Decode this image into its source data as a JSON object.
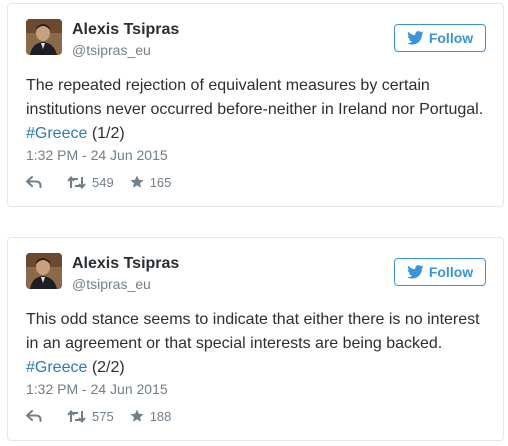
{
  "colors": {
    "accent": "#3b94d9",
    "hashtag": "#2b7bb9",
    "muted": "#707f8a",
    "text": "#292f33",
    "border": "#e1e8ed"
  },
  "tweets": [
    {
      "author": "Alexis Tsipras",
      "handle": "@tsipras_eu",
      "follow_label": "Follow",
      "text_line1": "The repeated rejection of equivalent measures by certain",
      "text_line2": "institutions never occurred before-neither in Ireland nor Portugal.",
      "hashtag": "#Greece",
      "suffix": " (1/2)",
      "timestamp": "1:32 PM - 24 Jun 2015",
      "retweets": "549",
      "likes": "165"
    },
    {
      "author": "Alexis Tsipras",
      "handle": "@tsipras_eu",
      "follow_label": "Follow",
      "text_line1": "This odd stance seems to indicate that either there is no interest",
      "text_line2": "in an agreement or that special interests are being backed.",
      "hashtag": "#Greece",
      "suffix": " (2/2)",
      "timestamp": "1:32 PM - 24 Jun 2015",
      "retweets": "575",
      "likes": "188"
    }
  ],
  "icons": {
    "bird": "twitter-bird-icon",
    "reply": "reply-icon",
    "retweet": "retweet-icon",
    "like": "star-icon"
  }
}
